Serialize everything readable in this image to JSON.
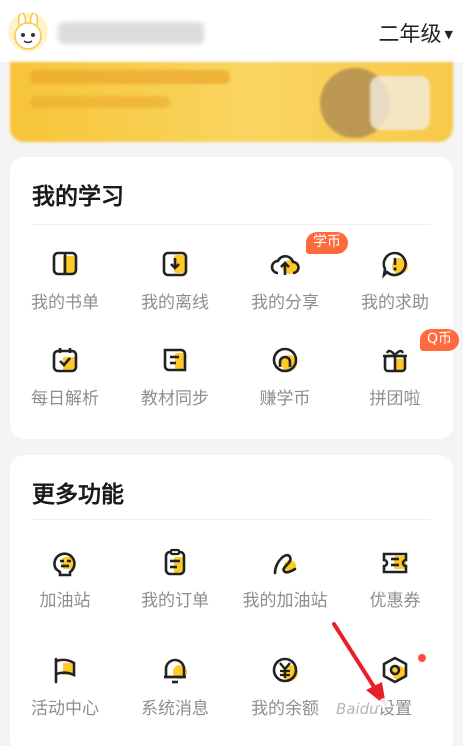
{
  "header": {
    "grade": "二年级"
  },
  "study": {
    "title": "我的学习",
    "items": [
      {
        "label": "我的书单",
        "icon": "book-icon"
      },
      {
        "label": "我的离线",
        "icon": "download-icon"
      },
      {
        "label": "我的分享",
        "icon": "cloud-upload-icon",
        "badge": "学币"
      },
      {
        "label": "我的求助",
        "icon": "help-bubble-icon"
      },
      {
        "label": "每日解析",
        "icon": "calendar-check-icon"
      },
      {
        "label": "教材同步",
        "icon": "textbook-icon"
      },
      {
        "label": "赚学币",
        "icon": "coin-icon"
      },
      {
        "label": "拼团啦",
        "icon": "gift-icon",
        "badge": "Q币"
      }
    ]
  },
  "more": {
    "title": "更多功能",
    "items": [
      {
        "label": "加油站",
        "icon": "robot-face-icon"
      },
      {
        "label": "我的订单",
        "icon": "clipboard-icon"
      },
      {
        "label": "我的加油站",
        "icon": "swirl-icon"
      },
      {
        "label": "优惠券",
        "icon": "ticket-icon"
      },
      {
        "label": "活动中心",
        "icon": "flag-icon"
      },
      {
        "label": "系统消息",
        "icon": "bell-icon"
      },
      {
        "label": "我的余额",
        "icon": "yuan-icon"
      },
      {
        "label": "设置",
        "icon": "settings-icon"
      }
    ]
  },
  "watermark": "Baidu",
  "colors": {
    "accent_yellow": "#ffc928",
    "badge_orange": "#ff6b3d",
    "arrow_red": "#e8202a"
  }
}
